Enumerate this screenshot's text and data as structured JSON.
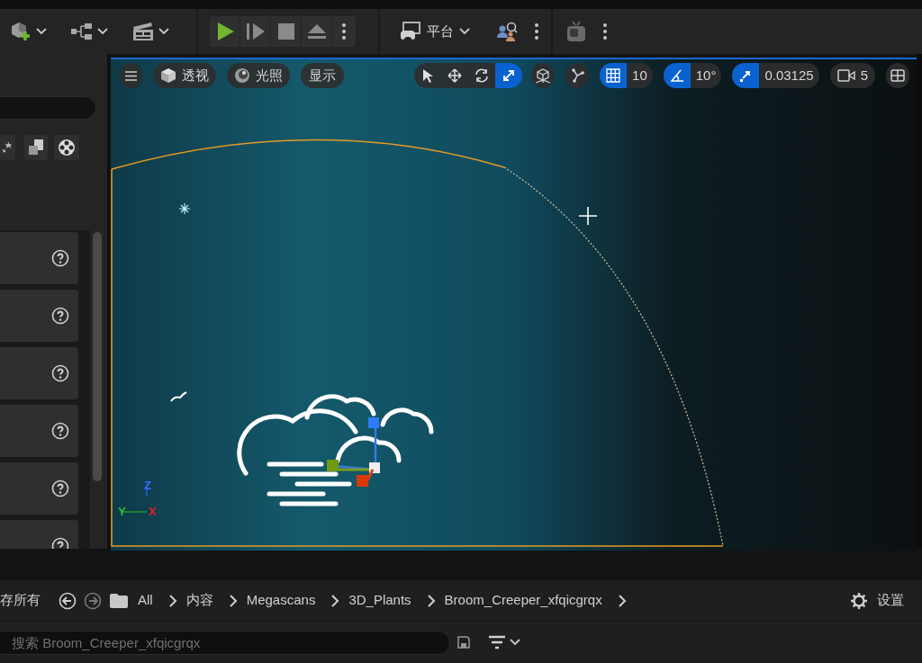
{
  "main_toolbar": {
    "platform_label": "平台"
  },
  "viewport": {
    "toolbar": {
      "view_mode": "透视",
      "lighting": "光照",
      "show": "显示",
      "transform_tools": [
        {
          "selected": false
        },
        {
          "selected": false
        },
        {
          "selected": false
        },
        {
          "selected": true
        }
      ],
      "grid_snap": {
        "on": true,
        "value": "10"
      },
      "rotation_snap": {
        "on": true,
        "value": "10°"
      },
      "scale_snap": {
        "on": true,
        "value": "0.03125"
      },
      "camera_speed": "5"
    },
    "axis_labels": {
      "z": "Z",
      "y": "Y",
      "x": "X"
    }
  },
  "content_browser": {
    "save_all": "存所有",
    "breadcrumbs": [
      "All",
      "内容",
      "Megascans",
      "3D_Plants",
      "Broom_Creeper_xfqicgrqx"
    ],
    "settings": "设置",
    "search": {
      "placeholder": "搜索 Broom_Creeper_xfqicgrqx"
    }
  }
}
